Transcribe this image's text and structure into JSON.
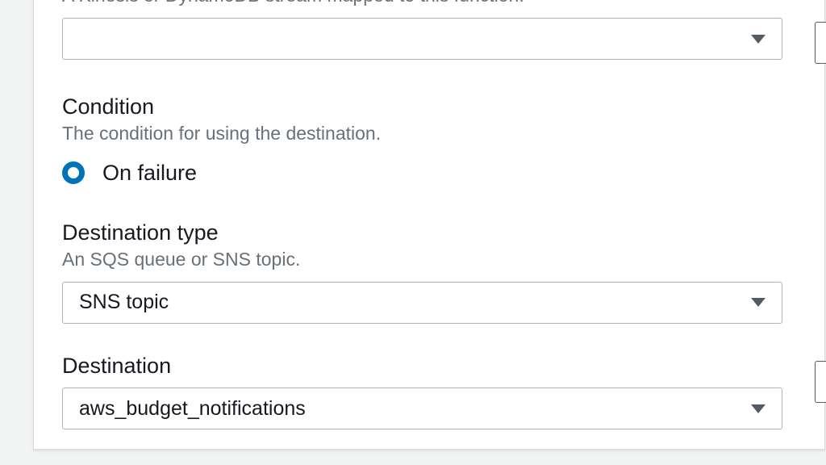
{
  "stream": {
    "description": "A Kinesis or DynamoDB stream mapped to this function.",
    "selected": ""
  },
  "condition": {
    "title": "Condition",
    "description": "The condition for using the destination.",
    "option_label": "On failure"
  },
  "destination_type": {
    "title": "Destination type",
    "description": "An SQS queue or SNS topic.",
    "selected": "SNS topic"
  },
  "destination": {
    "title": "Destination",
    "selected": "aws_budget_notifications"
  }
}
